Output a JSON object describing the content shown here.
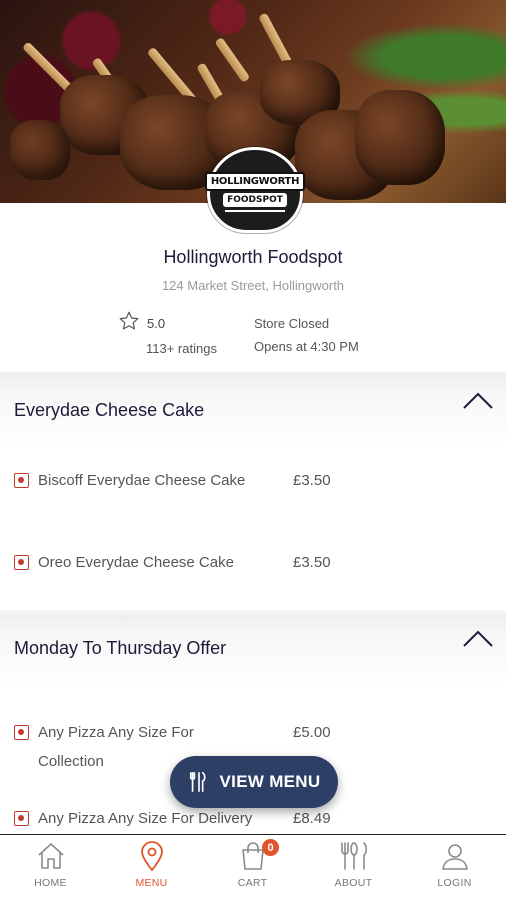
{
  "store": {
    "logo_text_top": "HOLLINGWORTH",
    "logo_text_bottom": "FOODSPOT",
    "name": "Hollingworth Foodspot",
    "address": "124 Market Street, Hollingworth",
    "rating": "5.0",
    "rating_count": "113+ ratings",
    "status": "Store Closed",
    "opens": "Opens at 4:30 PM"
  },
  "menu": {
    "sections": [
      {
        "title": "Everydae Cheese Cake",
        "items": [
          {
            "name": "Biscoff Everydae Cheese Cake",
            "price": "£3.50"
          },
          {
            "name": "Oreo Everydae Cheese Cake",
            "price": "£3.50"
          }
        ]
      },
      {
        "title": "Monday To Thursday Offer",
        "items": [
          {
            "name_line1": "Any Pizza Any Size For",
            "name_line2": "Collection",
            "price": "£5.00"
          },
          {
            "name": "Any Pizza Any Size For Delivery",
            "price": "£8.49"
          }
        ]
      }
    ]
  },
  "fab": {
    "label": "VIEW MENU",
    "icon": "cutlery-icon"
  },
  "tabbar": {
    "home": "HOME",
    "menu": "MENU",
    "cart": "CART",
    "cart_badge": "0",
    "about": "ABOUT",
    "login": "LOGIN"
  },
  "colors": {
    "accent": "#e0552d",
    "fab": "#2e3f66",
    "veg_marker": "#c0392b",
    "title": "#1b1b3a"
  }
}
